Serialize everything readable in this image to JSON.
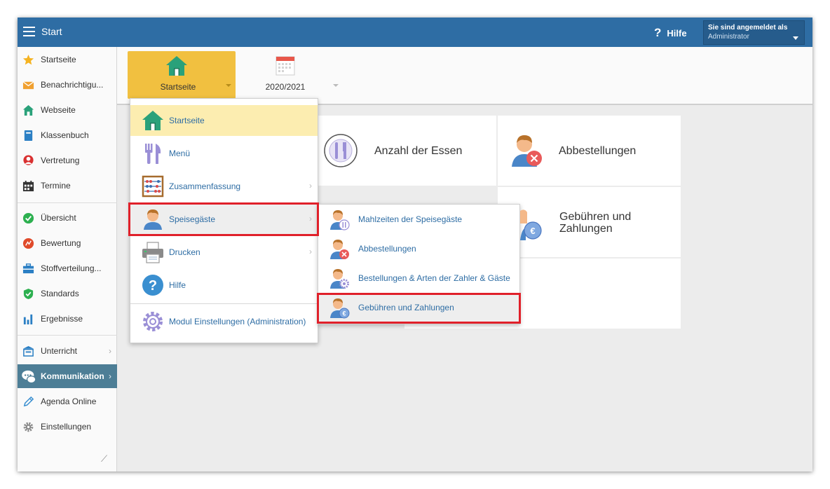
{
  "topbar": {
    "title": "Start",
    "help_label": "Hilfe",
    "user_line1": "Sie sind angemeldet als",
    "user_line2": "Administrator"
  },
  "sidebar": {
    "items": [
      {
        "label": "Startseite",
        "icon": "star-icon"
      },
      {
        "label": "Benachrichtigu...",
        "icon": "envelope-icon"
      },
      {
        "label": "Webseite",
        "icon": "house-icon"
      },
      {
        "label": "Klassenbuch",
        "icon": "book-icon"
      },
      {
        "label": "Vertretung",
        "icon": "substitute-person-icon"
      },
      {
        "label": "Termine",
        "icon": "calendar-icon"
      },
      {
        "label": "Übersicht",
        "icon": "check-circle-icon"
      },
      {
        "label": "Bewertung",
        "icon": "rating-icon"
      },
      {
        "label": "Stoffverteilung...",
        "icon": "briefcase-icon"
      },
      {
        "label": "Standards",
        "icon": "shield-check-icon"
      },
      {
        "label": "Ergebnisse",
        "icon": "bar-chart-icon"
      },
      {
        "label": "Unterricht",
        "icon": "classroom-icon"
      },
      {
        "label": "Kommunikation",
        "icon": "chat-icon"
      },
      {
        "label": "Agenda Online",
        "icon": "pen-icon"
      },
      {
        "label": "Einstellungen",
        "icon": "gear-icon"
      }
    ]
  },
  "header": {
    "tab_start_label": "Startseite",
    "tab_year_label": "2020/2021"
  },
  "tiles": {
    "anzahl": "Anzahl der Essen",
    "abbestellungen": "Abbestellungen",
    "gebuehren_line1": "Gebühren und",
    "gebuehren_line2": "Zahlungen"
  },
  "menu": {
    "items": [
      {
        "label": "Startseite",
        "icon": "house-icon"
      },
      {
        "label": "Menü",
        "icon": "cutlery-icon"
      },
      {
        "label": "Zusammenfassung",
        "icon": "abacus-icon"
      },
      {
        "label": "Speisegäste",
        "icon": "person-icon"
      },
      {
        "label": "Drucken",
        "icon": "printer-icon"
      },
      {
        "label": "Hilfe",
        "icon": "help-circle-icon"
      },
      {
        "label": "Modul Einstellungen (Administration)",
        "icon": "gear-icon"
      }
    ]
  },
  "submenu": {
    "items": [
      {
        "label": "Mahlzeiten der Speisegäste",
        "icon": "person-meal-icon"
      },
      {
        "label": "Abbestellungen",
        "icon": "person-cancel-icon"
      },
      {
        "label": "Bestellungen & Arten der Zahler & Gäste",
        "icon": "person-settings-icon"
      },
      {
        "label": "Gebühren und Zahlungen",
        "icon": "person-euro-icon"
      }
    ]
  },
  "colors": {
    "topbar": "#2e6da4",
    "accent_yellow": "#f1c040",
    "highlight_red": "#e0202a",
    "sidebar_active": "#4d7e96"
  }
}
